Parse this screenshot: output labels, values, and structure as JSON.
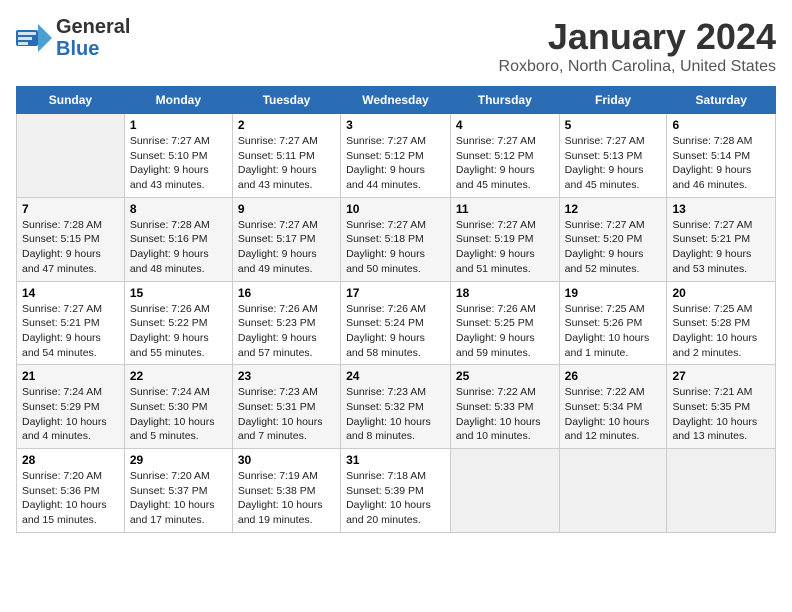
{
  "header": {
    "logo_line1": "General",
    "logo_line2": "Blue",
    "title": "January 2024",
    "subtitle": "Roxboro, North Carolina, United States"
  },
  "columns": [
    "Sunday",
    "Monday",
    "Tuesday",
    "Wednesday",
    "Thursday",
    "Friday",
    "Saturday"
  ],
  "weeks": [
    [
      {
        "day": "",
        "info": ""
      },
      {
        "day": "1",
        "info": "Sunrise: 7:27 AM\nSunset: 5:10 PM\nDaylight: 9 hours\nand 43 minutes."
      },
      {
        "day": "2",
        "info": "Sunrise: 7:27 AM\nSunset: 5:11 PM\nDaylight: 9 hours\nand 43 minutes."
      },
      {
        "day": "3",
        "info": "Sunrise: 7:27 AM\nSunset: 5:12 PM\nDaylight: 9 hours\nand 44 minutes."
      },
      {
        "day": "4",
        "info": "Sunrise: 7:27 AM\nSunset: 5:12 PM\nDaylight: 9 hours\nand 45 minutes."
      },
      {
        "day": "5",
        "info": "Sunrise: 7:27 AM\nSunset: 5:13 PM\nDaylight: 9 hours\nand 45 minutes."
      },
      {
        "day": "6",
        "info": "Sunrise: 7:28 AM\nSunset: 5:14 PM\nDaylight: 9 hours\nand 46 minutes."
      }
    ],
    [
      {
        "day": "7",
        "info": "Sunrise: 7:28 AM\nSunset: 5:15 PM\nDaylight: 9 hours\nand 47 minutes."
      },
      {
        "day": "8",
        "info": "Sunrise: 7:28 AM\nSunset: 5:16 PM\nDaylight: 9 hours\nand 48 minutes."
      },
      {
        "day": "9",
        "info": "Sunrise: 7:27 AM\nSunset: 5:17 PM\nDaylight: 9 hours\nand 49 minutes."
      },
      {
        "day": "10",
        "info": "Sunrise: 7:27 AM\nSunset: 5:18 PM\nDaylight: 9 hours\nand 50 minutes."
      },
      {
        "day": "11",
        "info": "Sunrise: 7:27 AM\nSunset: 5:19 PM\nDaylight: 9 hours\nand 51 minutes."
      },
      {
        "day": "12",
        "info": "Sunrise: 7:27 AM\nSunset: 5:20 PM\nDaylight: 9 hours\nand 52 minutes."
      },
      {
        "day": "13",
        "info": "Sunrise: 7:27 AM\nSunset: 5:21 PM\nDaylight: 9 hours\nand 53 minutes."
      }
    ],
    [
      {
        "day": "14",
        "info": "Sunrise: 7:27 AM\nSunset: 5:21 PM\nDaylight: 9 hours\nand 54 minutes."
      },
      {
        "day": "15",
        "info": "Sunrise: 7:26 AM\nSunset: 5:22 PM\nDaylight: 9 hours\nand 55 minutes."
      },
      {
        "day": "16",
        "info": "Sunrise: 7:26 AM\nSunset: 5:23 PM\nDaylight: 9 hours\nand 57 minutes."
      },
      {
        "day": "17",
        "info": "Sunrise: 7:26 AM\nSunset: 5:24 PM\nDaylight: 9 hours\nand 58 minutes."
      },
      {
        "day": "18",
        "info": "Sunrise: 7:26 AM\nSunset: 5:25 PM\nDaylight: 9 hours\nand 59 minutes."
      },
      {
        "day": "19",
        "info": "Sunrise: 7:25 AM\nSunset: 5:26 PM\nDaylight: 10 hours\nand 1 minute."
      },
      {
        "day": "20",
        "info": "Sunrise: 7:25 AM\nSunset: 5:28 PM\nDaylight: 10 hours\nand 2 minutes."
      }
    ],
    [
      {
        "day": "21",
        "info": "Sunrise: 7:24 AM\nSunset: 5:29 PM\nDaylight: 10 hours\nand 4 minutes."
      },
      {
        "day": "22",
        "info": "Sunrise: 7:24 AM\nSunset: 5:30 PM\nDaylight: 10 hours\nand 5 minutes."
      },
      {
        "day": "23",
        "info": "Sunrise: 7:23 AM\nSunset: 5:31 PM\nDaylight: 10 hours\nand 7 minutes."
      },
      {
        "day": "24",
        "info": "Sunrise: 7:23 AM\nSunset: 5:32 PM\nDaylight: 10 hours\nand 8 minutes."
      },
      {
        "day": "25",
        "info": "Sunrise: 7:22 AM\nSunset: 5:33 PM\nDaylight: 10 hours\nand 10 minutes."
      },
      {
        "day": "26",
        "info": "Sunrise: 7:22 AM\nSunset: 5:34 PM\nDaylight: 10 hours\nand 12 minutes."
      },
      {
        "day": "27",
        "info": "Sunrise: 7:21 AM\nSunset: 5:35 PM\nDaylight: 10 hours\nand 13 minutes."
      }
    ],
    [
      {
        "day": "28",
        "info": "Sunrise: 7:20 AM\nSunset: 5:36 PM\nDaylight: 10 hours\nand 15 minutes."
      },
      {
        "day": "29",
        "info": "Sunrise: 7:20 AM\nSunset: 5:37 PM\nDaylight: 10 hours\nand 17 minutes."
      },
      {
        "day": "30",
        "info": "Sunrise: 7:19 AM\nSunset: 5:38 PM\nDaylight: 10 hours\nand 19 minutes."
      },
      {
        "day": "31",
        "info": "Sunrise: 7:18 AM\nSunset: 5:39 PM\nDaylight: 10 hours\nand 20 minutes."
      },
      {
        "day": "",
        "info": ""
      },
      {
        "day": "",
        "info": ""
      },
      {
        "day": "",
        "info": ""
      }
    ]
  ]
}
